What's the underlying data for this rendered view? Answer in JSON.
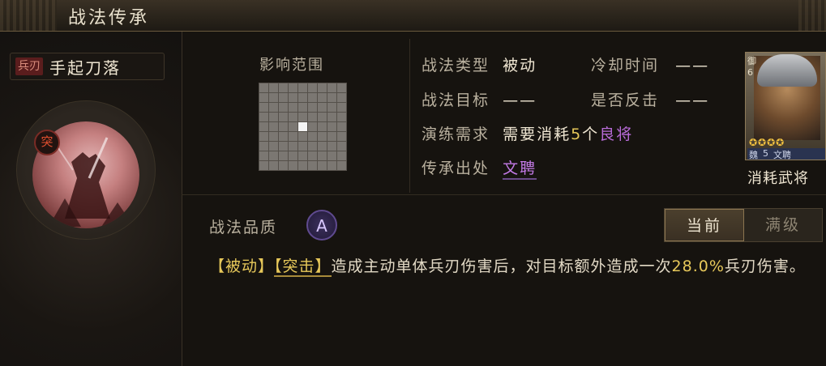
{
  "window": {
    "title": "战法传承"
  },
  "skill": {
    "type_badge": "兵刃",
    "name": "手起刀落",
    "portrait_badge": "突"
  },
  "range": {
    "label": "影响范围",
    "grid_size": 9,
    "highlighted_cells": [
      [
        4,
        4
      ]
    ]
  },
  "info": {
    "type_label": "战法类型",
    "type_value": "被动",
    "cooldown_label": "冷却时间",
    "cooldown_value": "——",
    "target_label": "战法目标",
    "target_value": "——",
    "counter_label": "是否反击",
    "counter_value": "——",
    "req_label": "演练需求",
    "req_prefix": "需要消耗",
    "req_count": "5",
    "req_unit": "个",
    "req_item": "良将",
    "source_label": "传承出处",
    "source_value": "文聘"
  },
  "general_card": {
    "side_text": "御 6",
    "stars": "✪✪✪✪",
    "kingdom": "魏",
    "cost": "5",
    "name": "文聘",
    "label": "消耗武将"
  },
  "quality": {
    "label": "战法品质",
    "grade": "A"
  },
  "toggle": {
    "current": "当前",
    "max": "满级"
  },
  "description": {
    "tag1": "【被动】",
    "tag2": "【突击】",
    "text_before": "造成主动单体兵刃伤害后，对目标额外造成一次",
    "percent": "28.0%",
    "text_after": "兵刃伤害。"
  },
  "colors": {
    "accent_gold": "#e7c85a",
    "accent_purple": "#c37ae6",
    "badge_red": "#5a1d1d"
  }
}
